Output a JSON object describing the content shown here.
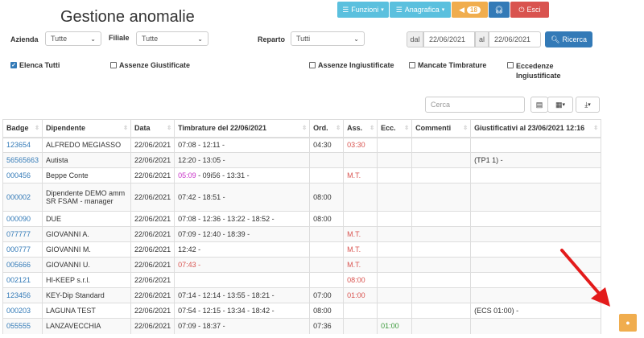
{
  "page": {
    "title": "Gestione anomalie"
  },
  "topbar": {
    "funzioni": "Funzioni",
    "anagrafica": "Anagrafica",
    "notifiche_count": "18",
    "esci": "Esci"
  },
  "filters": {
    "azienda_label": "Azienda",
    "azienda_value": "Tutte",
    "filiale_label": "Filiale",
    "filiale_value": "Tutte",
    "reparto_label": "Reparto",
    "reparto_value": "Tutti",
    "dal_label": "dal",
    "dal_value": "22/06/2021",
    "al_label": "al",
    "al_value": "22/06/2021",
    "ricerca_label": "Ricerca"
  },
  "checks": {
    "elenca_tutti": "Elenca Tutti",
    "assenze_giustificate": "Assenze Giustificate",
    "assenze_ingiustificate": "Assenze Ingiustificate",
    "mancate_timbrature": "Mancate Timbrature",
    "eccedenze_l1": "Eccedenze",
    "eccedenze_l2": "Ingiustificate"
  },
  "search": {
    "placeholder": "Cerca"
  },
  "table": {
    "headers": [
      "Badge",
      "Dipendente",
      "Data",
      "Timbrature del 22/06/2021",
      "Ord.",
      "Ass.",
      "Ecc.",
      "Commenti",
      "Giustificativi al 23/06/2021 12:16"
    ],
    "rows": [
      {
        "badge": "123654",
        "dip": "ALFREDO MEGIASSO",
        "dip2": "",
        "data": "22/06/2021",
        "timb_a": "",
        "timb_b": "07:08 - 12:11 -",
        "ord": "04:30",
        "ass": "03:30",
        "ecc": "",
        "comm": "",
        "giust": ""
      },
      {
        "badge": "56565663",
        "dip": "Autista",
        "dip2": "",
        "data": "22/06/2021",
        "timb_a": "",
        "timb_b": "12:20 - 13:05 -",
        "ord": "",
        "ass": "",
        "ecc": "",
        "comm": "",
        "giust": "(TP1 1) -"
      },
      {
        "badge": "000456",
        "dip": "Beppe Conte",
        "dip2": "",
        "data": "22/06/2021",
        "timb_a": "05:09",
        "timb_b": " - 09i56 - 13:31 -",
        "ord": "",
        "ass": "M.T.",
        "ecc": "",
        "comm": "",
        "giust": ""
      },
      {
        "badge": "000002",
        "dip": "Dipendente DEMO amm",
        "dip2": "SR FSAM - manager",
        "data": "22/06/2021",
        "timb_a": "",
        "timb_b": "07:42 - 18:51 -",
        "ord": "08:00",
        "ass": "",
        "ecc": "",
        "comm": "",
        "giust": ""
      },
      {
        "badge": "000090",
        "dip": "DUE",
        "dip2": "",
        "data": "22/06/2021",
        "timb_a": "",
        "timb_b": "07:08 - 12:36 - 13:22 - 18:52 -",
        "ord": "08:00",
        "ass": "",
        "ecc": "",
        "comm": "",
        "giust": ""
      },
      {
        "badge": "077777",
        "dip": "GIOVANNI A.",
        "dip2": "",
        "data": "22/06/2021",
        "timb_a": "",
        "timb_b": "07:09 - 12:40 - 18:39 -",
        "ord": "",
        "ass": "M.T.",
        "ecc": "",
        "comm": "",
        "giust": ""
      },
      {
        "badge": "000777",
        "dip": "GIOVANNI M.",
        "dip2": "",
        "data": "22/06/2021",
        "timb_a": "",
        "timb_b": "12:42 -",
        "ord": "",
        "ass": "M.T.",
        "ecc": "",
        "comm": "",
        "giust": ""
      },
      {
        "badge": "005666",
        "dip": "GIOVANNI U.",
        "dip2": "",
        "data": "22/06/2021",
        "timb_a": "07:43 -",
        "timb_b": "",
        "ord": "",
        "ass": "M.T.",
        "ecc": "",
        "comm": "",
        "giust": ""
      },
      {
        "badge": "002121",
        "dip": "HI-KEEP s.r.l.",
        "dip2": "",
        "data": "22/06/2021",
        "timb_a": "",
        "timb_b": "",
        "ord": "",
        "ass": "08:00",
        "ecc": "",
        "comm": "",
        "giust": ""
      },
      {
        "badge": "123456",
        "dip": "KEY-Dip Standard",
        "dip2": "",
        "data": "22/06/2021",
        "timb_a": "",
        "timb_b": "07:14 - 12:14 - 13:55 - 18:21 -",
        "ord": "07:00",
        "ass": "01:00",
        "ecc": "",
        "comm": "",
        "giust": ""
      },
      {
        "badge": "000203",
        "dip": "LAGUNA TEST",
        "dip2": "",
        "data": "22/06/2021",
        "timb_a": "",
        "timb_b": "07:54 - 12:15 - 13:34 - 18:42 -",
        "ord": "08:00",
        "ass": "",
        "ecc": "",
        "comm": "",
        "giust": "(ECS 01:00) -"
      },
      {
        "badge": "055555",
        "dip": "LANZAVECCHIA",
        "dip2": "",
        "data": "22/06/2021",
        "timb_a": "",
        "timb_b": "07:09 - 18:37 -",
        "ord": "07:36",
        "ass": "",
        "ecc": "01:00",
        "comm": "",
        "giust": ""
      }
    ]
  },
  "colors": {
    "primary": "#337ab7",
    "info": "#5bc0de",
    "warning": "#f0ad4e",
    "danger": "#d9534f"
  }
}
